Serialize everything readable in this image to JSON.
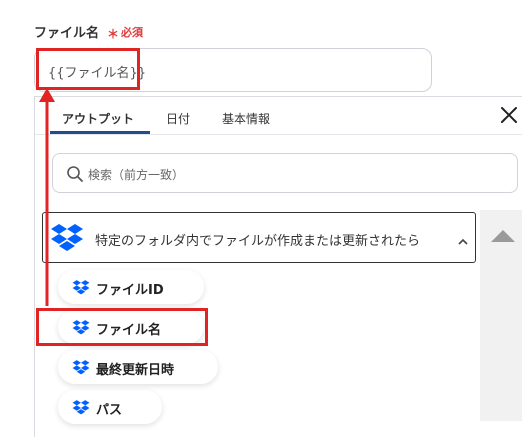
{
  "field": {
    "label": "ファイル名",
    "required_mark": "＊",
    "required_text": "必須",
    "value": "{{ファイル名}}"
  },
  "tabs": [
    {
      "label": "アウトプット",
      "active": true
    },
    {
      "label": "日付",
      "active": false
    },
    {
      "label": "基本情報",
      "active": false
    }
  ],
  "close_icon": "close-icon",
  "search": {
    "placeholder": "検索（前方一致）"
  },
  "group": {
    "label": "特定のフォルダ内でファイルが作成または更新されたら",
    "icon": "dropbox-icon",
    "expanded": true
  },
  "items": [
    {
      "label": "ファイルID",
      "icon": "dropbox-icon",
      "highlighted": false
    },
    {
      "label": "ファイル名",
      "icon": "dropbox-icon",
      "highlighted": true
    },
    {
      "label": "最終更新日時",
      "icon": "dropbox-icon",
      "highlighted": false
    },
    {
      "label": "パス",
      "icon": "dropbox-icon",
      "highlighted": false
    }
  ],
  "colors": {
    "dropbox": "#0061fe",
    "annotation_red": "#e02424",
    "required": "#e03a3a",
    "tab_active": "#1f4d8f"
  }
}
